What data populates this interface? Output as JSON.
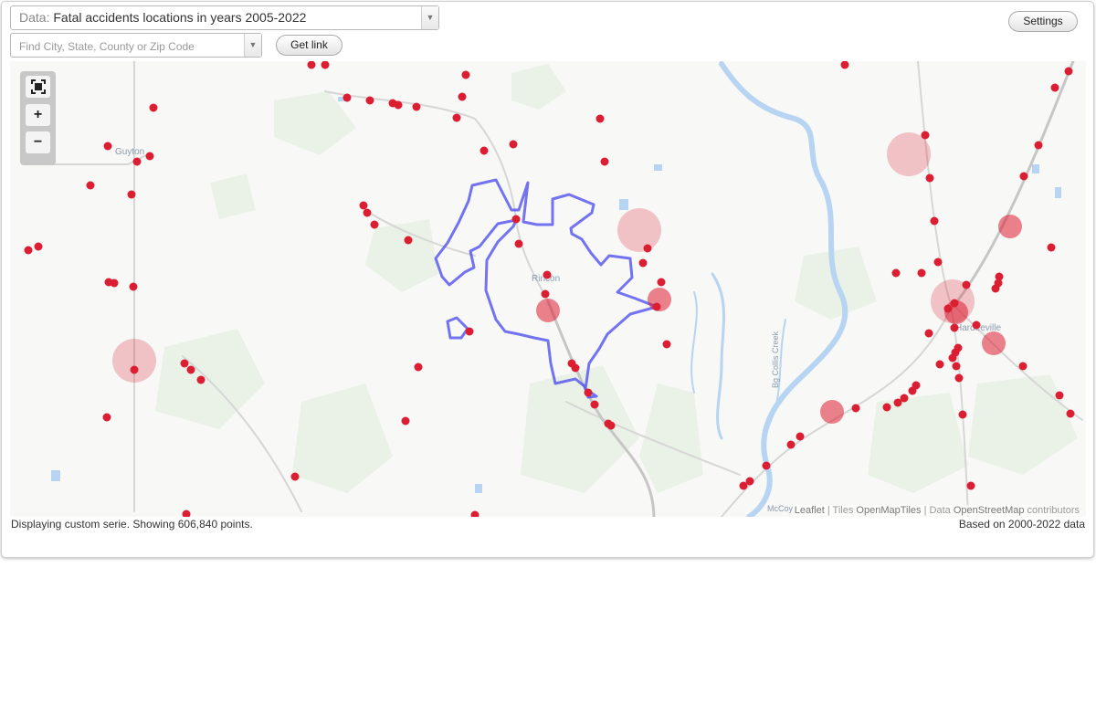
{
  "controls": {
    "data_prefix": "Data:",
    "data_value": "Fatal accidents locations in years 2005-2022",
    "search_placeholder": "Find City, State, County or Zip Code",
    "get_link_label": "Get link",
    "settings_label": "Settings",
    "dropdown_arrow": "▼"
  },
  "zoom": {
    "fullscreen_icon": "fullscreen-icon",
    "plus_label": "+",
    "minus_label": "−"
  },
  "map": {
    "places": {
      "guyton": "Guyton",
      "rincon": "Rincon",
      "hardeeville": "Hardeeville",
      "creek": "Bg Collis Creek",
      "mccoy": "McCoy"
    },
    "colors": {
      "marker": "#dc1e32",
      "cluster": "#dc1e32",
      "boundary": "#3a3af0",
      "water": "#b7d4f2",
      "green": "#e9f2e6"
    }
  },
  "attribution": {
    "leaflet": "Leaflet",
    "sep1": " | Tiles ",
    "tiles": "OpenMapTiles",
    "sep2": " | Data ",
    "data": "OpenStreetMap",
    "suffix": " contributors"
  },
  "status": {
    "left": "Displaying custom serie. Showing 606,840 points.",
    "right": "Based on 2000-2022 data"
  }
}
